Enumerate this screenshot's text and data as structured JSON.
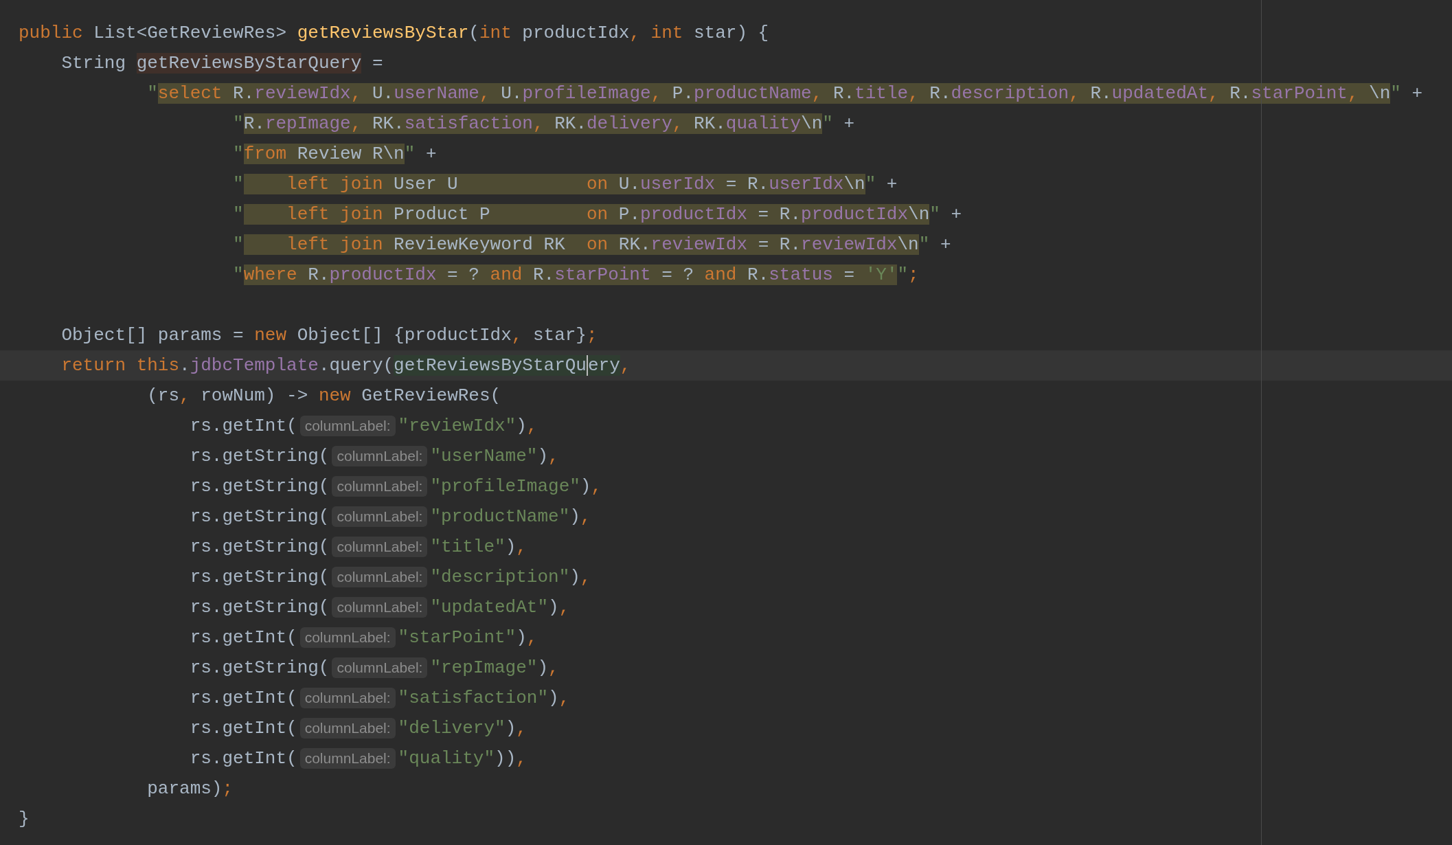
{
  "lines": [
    {
      "tokens": [
        {
          "kind": "k",
          "text": "public"
        },
        {
          "kind": "p",
          "text": " List<GetReviewRes> "
        },
        {
          "kind": "m",
          "text": "getReviewsByStar"
        },
        {
          "kind": "p",
          "text": "("
        },
        {
          "kind": "k",
          "text": "int"
        },
        {
          "kind": "p",
          "text": " productIdx"
        },
        {
          "kind": "k",
          "text": ", int"
        },
        {
          "kind": "p",
          "text": " star) {"
        }
      ]
    },
    {
      "tokens": [
        {
          "kind": "p",
          "text": "    String "
        },
        {
          "kind": "w",
          "text": "getReviewsByStarQuery"
        },
        {
          "kind": "p",
          "text": " ="
        }
      ]
    },
    {
      "tokens": [
        {
          "kind": "s",
          "text": "            \""
        },
        {
          "kind": "sk",
          "text": "select"
        },
        {
          "kind": "sp",
          "text": " R."
        },
        {
          "kind": "sf",
          "text": "reviewIdx"
        },
        {
          "kind": "sk",
          "text": ","
        },
        {
          "kind": "sp",
          "text": " U."
        },
        {
          "kind": "sf",
          "text": "userName"
        },
        {
          "kind": "sk",
          "text": ","
        },
        {
          "kind": "sp",
          "text": " U."
        },
        {
          "kind": "sf",
          "text": "profileImage"
        },
        {
          "kind": "sk",
          "text": ","
        },
        {
          "kind": "sp",
          "text": " P."
        },
        {
          "kind": "sf",
          "text": "productName"
        },
        {
          "kind": "sk",
          "text": ","
        },
        {
          "kind": "sp",
          "text": " R."
        },
        {
          "kind": "sf",
          "text": "title"
        },
        {
          "kind": "sk",
          "text": ","
        },
        {
          "kind": "sp",
          "text": " R."
        },
        {
          "kind": "sf",
          "text": "description"
        },
        {
          "kind": "sk",
          "text": ","
        },
        {
          "kind": "sp",
          "text": " R."
        },
        {
          "kind": "sf",
          "text": "updatedAt"
        },
        {
          "kind": "sk",
          "text": ","
        },
        {
          "kind": "sp",
          "text": " R."
        },
        {
          "kind": "sf",
          "text": "starPoint"
        },
        {
          "kind": "sk",
          "text": ","
        },
        {
          "kind": "sp",
          "text": " \\n"
        },
        {
          "kind": "s",
          "text": "\""
        },
        {
          "kind": "p",
          "text": " +"
        }
      ]
    },
    {
      "tokens": [
        {
          "kind": "s",
          "text": "                    \""
        },
        {
          "kind": "sp",
          "text": "R."
        },
        {
          "kind": "sf",
          "text": "repImage"
        },
        {
          "kind": "sk",
          "text": ","
        },
        {
          "kind": "sp",
          "text": " RK."
        },
        {
          "kind": "sf",
          "text": "satisfaction"
        },
        {
          "kind": "sk",
          "text": ","
        },
        {
          "kind": "sp",
          "text": " RK."
        },
        {
          "kind": "sf",
          "text": "delivery"
        },
        {
          "kind": "sk",
          "text": ","
        },
        {
          "kind": "sp",
          "text": " RK."
        },
        {
          "kind": "sf",
          "text": "quality"
        },
        {
          "kind": "sp",
          "text": "\\n"
        },
        {
          "kind": "s",
          "text": "\""
        },
        {
          "kind": "p",
          "text": " +"
        }
      ]
    },
    {
      "tokens": [
        {
          "kind": "s",
          "text": "                    \""
        },
        {
          "kind": "sk",
          "text": "from"
        },
        {
          "kind": "sp",
          "text": " Review R\\n"
        },
        {
          "kind": "s",
          "text": "\""
        },
        {
          "kind": "p",
          "text": " +"
        }
      ]
    },
    {
      "tokens": [
        {
          "kind": "s",
          "text": "                    \""
        },
        {
          "kind": "sk",
          "text": "    left join"
        },
        {
          "kind": "sp",
          "text": " User U            "
        },
        {
          "kind": "sk",
          "text": "on"
        },
        {
          "kind": "sp",
          "text": " U."
        },
        {
          "kind": "sf",
          "text": "userIdx"
        },
        {
          "kind": "sp",
          "text": " = R."
        },
        {
          "kind": "sf",
          "text": "userIdx"
        },
        {
          "kind": "sp",
          "text": "\\n"
        },
        {
          "kind": "s",
          "text": "\""
        },
        {
          "kind": "p",
          "text": " +"
        }
      ]
    },
    {
      "tokens": [
        {
          "kind": "s",
          "text": "                    \""
        },
        {
          "kind": "sk",
          "text": "    left join"
        },
        {
          "kind": "sp",
          "text": " Product P         "
        },
        {
          "kind": "sk",
          "text": "on"
        },
        {
          "kind": "sp",
          "text": " P."
        },
        {
          "kind": "sf",
          "text": "productIdx"
        },
        {
          "kind": "sp",
          "text": " = R."
        },
        {
          "kind": "sf",
          "text": "productIdx"
        },
        {
          "kind": "sp",
          "text": "\\n"
        },
        {
          "kind": "s",
          "text": "\""
        },
        {
          "kind": "p",
          "text": " +"
        }
      ]
    },
    {
      "tokens": [
        {
          "kind": "s",
          "text": "                    \""
        },
        {
          "kind": "sk",
          "text": "    left join"
        },
        {
          "kind": "sp",
          "text": " ReviewKeyword RK  "
        },
        {
          "kind": "sk",
          "text": "on"
        },
        {
          "kind": "sp",
          "text": " RK."
        },
        {
          "kind": "sf",
          "text": "reviewIdx"
        },
        {
          "kind": "sp",
          "text": " = R."
        },
        {
          "kind": "sf",
          "text": "reviewIdx"
        },
        {
          "kind": "sp",
          "text": "\\n"
        },
        {
          "kind": "s",
          "text": "\""
        },
        {
          "kind": "p",
          "text": " +"
        }
      ]
    },
    {
      "tokens": [
        {
          "kind": "s",
          "text": "                    \""
        },
        {
          "kind": "sk",
          "text": "where"
        },
        {
          "kind": "sp",
          "text": " R."
        },
        {
          "kind": "sf",
          "text": "productIdx"
        },
        {
          "kind": "sp",
          "text": " = ? "
        },
        {
          "kind": "sk",
          "text": "and"
        },
        {
          "kind": "sp",
          "text": " R."
        },
        {
          "kind": "sf",
          "text": "starPoint"
        },
        {
          "kind": "sp",
          "text": " = ? "
        },
        {
          "kind": "sk",
          "text": "and"
        },
        {
          "kind": "sp",
          "text": " R."
        },
        {
          "kind": "sf",
          "text": "status"
        },
        {
          "kind": "sp",
          "text": " = "
        },
        {
          "kind": "sq",
          "text": "'Y'"
        },
        {
          "kind": "s",
          "text": "\""
        },
        {
          "kind": "k",
          "text": ";"
        }
      ]
    },
    {
      "kind": "blank"
    },
    {
      "tokens": [
        {
          "kind": "p",
          "text": "    Object[] params = "
        },
        {
          "kind": "k",
          "text": "new"
        },
        {
          "kind": "p",
          "text": " Object[] {productIdx"
        },
        {
          "kind": "k",
          "text": ","
        },
        {
          "kind": "p",
          "text": " star}"
        },
        {
          "kind": "k",
          "text": ";"
        }
      ]
    },
    {
      "current": true,
      "tokens": [
        {
          "kind": "k",
          "text": "    return this"
        },
        {
          "kind": "p",
          "text": "."
        },
        {
          "kind": "f",
          "text": "jdbcTemplate"
        },
        {
          "kind": "p",
          "text": ".query("
        },
        {
          "kind": "r",
          "text": "getReviewsByStarQu"
        },
        {
          "kind": "c",
          "text": "ery"
        },
        {
          "kind": "k",
          "text": ","
        }
      ]
    },
    {
      "tokens": [
        {
          "kind": "p",
          "text": "            (rs"
        },
        {
          "kind": "k",
          "text": ","
        },
        {
          "kind": "p",
          "text": " rowNum) -> "
        },
        {
          "kind": "k",
          "text": "new"
        },
        {
          "kind": "p",
          "text": " GetReviewRes("
        }
      ]
    },
    {
      "tokens": [
        {
          "kind": "p",
          "text": "                rs.getInt("
        },
        {
          "kind": "h",
          "text": "columnLabel:"
        },
        {
          "kind": "s",
          "text": "\"reviewIdx\""
        },
        {
          "kind": "p",
          "text": ")"
        },
        {
          "kind": "k",
          "text": ","
        }
      ]
    },
    {
      "tokens": [
        {
          "kind": "p",
          "text": "                rs.getString("
        },
        {
          "kind": "h",
          "text": "columnLabel:"
        },
        {
          "kind": "s",
          "text": "\"userName\""
        },
        {
          "kind": "p",
          "text": ")"
        },
        {
          "kind": "k",
          "text": ","
        }
      ]
    },
    {
      "tokens": [
        {
          "kind": "p",
          "text": "                rs.getString("
        },
        {
          "kind": "h",
          "text": "columnLabel:"
        },
        {
          "kind": "s",
          "text": "\"profileImage\""
        },
        {
          "kind": "p",
          "text": ")"
        },
        {
          "kind": "k",
          "text": ","
        }
      ]
    },
    {
      "tokens": [
        {
          "kind": "p",
          "text": "                rs.getString("
        },
        {
          "kind": "h",
          "text": "columnLabel:"
        },
        {
          "kind": "s",
          "text": "\"productName\""
        },
        {
          "kind": "p",
          "text": ")"
        },
        {
          "kind": "k",
          "text": ","
        }
      ]
    },
    {
      "tokens": [
        {
          "kind": "p",
          "text": "                rs.getString("
        },
        {
          "kind": "h",
          "text": "columnLabel:"
        },
        {
          "kind": "s",
          "text": "\"title\""
        },
        {
          "kind": "p",
          "text": ")"
        },
        {
          "kind": "k",
          "text": ","
        }
      ]
    },
    {
      "tokens": [
        {
          "kind": "p",
          "text": "                rs.getString("
        },
        {
          "kind": "h",
          "text": "columnLabel:"
        },
        {
          "kind": "s",
          "text": "\"description\""
        },
        {
          "kind": "p",
          "text": ")"
        },
        {
          "kind": "k",
          "text": ","
        }
      ]
    },
    {
      "tokens": [
        {
          "kind": "p",
          "text": "                rs.getString("
        },
        {
          "kind": "h",
          "text": "columnLabel:"
        },
        {
          "kind": "s",
          "text": "\"updatedAt\""
        },
        {
          "kind": "p",
          "text": ")"
        },
        {
          "kind": "k",
          "text": ","
        }
      ]
    },
    {
      "tokens": [
        {
          "kind": "p",
          "text": "                rs.getInt("
        },
        {
          "kind": "h",
          "text": "columnLabel:"
        },
        {
          "kind": "s",
          "text": "\"starPoint\""
        },
        {
          "kind": "p",
          "text": ")"
        },
        {
          "kind": "k",
          "text": ","
        }
      ]
    },
    {
      "tokens": [
        {
          "kind": "p",
          "text": "                rs.getString("
        },
        {
          "kind": "h",
          "text": "columnLabel:"
        },
        {
          "kind": "s",
          "text": "\"repImage\""
        },
        {
          "kind": "p",
          "text": ")"
        },
        {
          "kind": "k",
          "text": ","
        }
      ]
    },
    {
      "tokens": [
        {
          "kind": "p",
          "text": "                rs.getInt("
        },
        {
          "kind": "h",
          "text": "columnLabel:"
        },
        {
          "kind": "s",
          "text": "\"satisfaction\""
        },
        {
          "kind": "p",
          "text": ")"
        },
        {
          "kind": "k",
          "text": ","
        }
      ]
    },
    {
      "tokens": [
        {
          "kind": "p",
          "text": "                rs.getInt("
        },
        {
          "kind": "h",
          "text": "columnLabel:"
        },
        {
          "kind": "s",
          "text": "\"delivery\""
        },
        {
          "kind": "p",
          "text": ")"
        },
        {
          "kind": "k",
          "text": ","
        }
      ]
    },
    {
      "tokens": [
        {
          "kind": "p",
          "text": "                rs.getInt("
        },
        {
          "kind": "h",
          "text": "columnLabel:"
        },
        {
          "kind": "s",
          "text": "\"quality\""
        },
        {
          "kind": "p",
          "text": "))"
        },
        {
          "kind": "k",
          "text": ","
        }
      ]
    },
    {
      "tokens": [
        {
          "kind": "p",
          "text": "            params)"
        },
        {
          "kind": "k",
          "text": ";"
        }
      ]
    },
    {
      "tokens": [
        {
          "kind": "p",
          "text": "}"
        }
      ]
    }
  ]
}
